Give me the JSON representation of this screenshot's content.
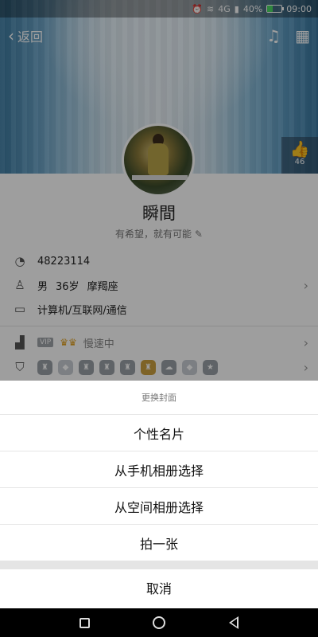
{
  "status_bar": {
    "battery": "40%",
    "time": "09:00",
    "network": "4G"
  },
  "header": {
    "back_label": "返回"
  },
  "cover": {
    "like_count": "46"
  },
  "profile": {
    "name": "瞬間",
    "signature": "有希望，就有可能",
    "qq": "48223114",
    "gender": "男",
    "age": "36岁",
    "zodiac": "摩羯座",
    "industry": "计算机/互联网/通信",
    "vip_tag": "VIP",
    "speed": "慢速中"
  },
  "action_sheet": {
    "title": "更换封面",
    "items": [
      "个性名片",
      "从手机相册选择",
      "从空间相册选择",
      "拍一张"
    ],
    "cancel": "取消"
  }
}
